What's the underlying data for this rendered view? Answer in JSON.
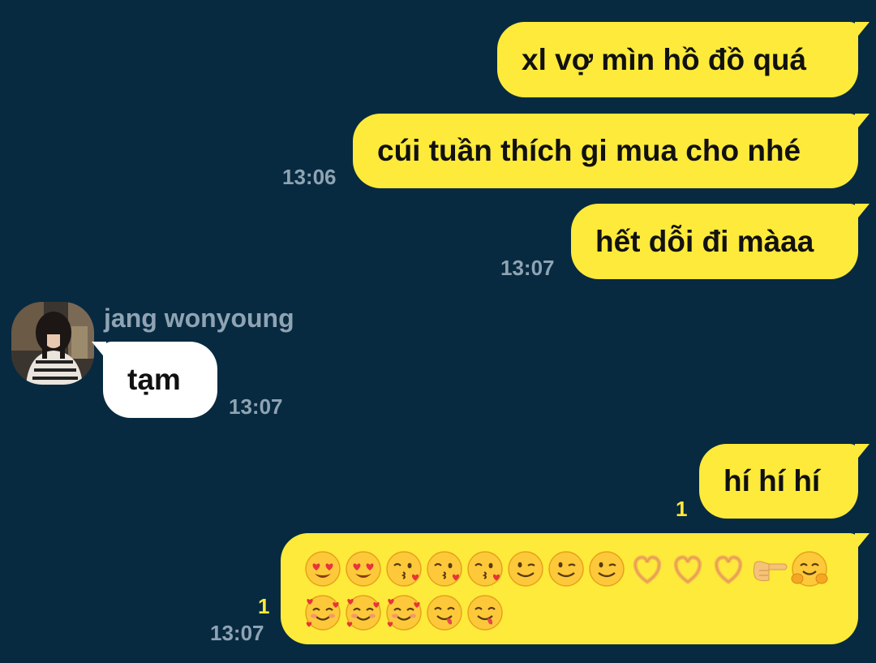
{
  "messages": {
    "m1": {
      "text": "xl vợ mìn hồ đồ quá"
    },
    "m2": {
      "text": "cúi tuần thích gi mua cho nhé",
      "time": "13:06"
    },
    "m3": {
      "text": "hết dỗi đi màaa",
      "time": "13:07"
    },
    "m4": {
      "sender": "jang wonyoung",
      "text": "tạm",
      "time": "13:07"
    },
    "m5": {
      "text": "hí hí hí",
      "unread": "1"
    },
    "m6": {
      "unread": "1",
      "time": "13:07",
      "emojis_row1": [
        "heart-eyes",
        "heart-eyes",
        "kiss-heart",
        "kiss-heart",
        "kiss-heart",
        "wink",
        "wink",
        "wink",
        "heart-hands",
        "heart-hands",
        "heart-hands",
        "pointing-right",
        "hugging"
      ],
      "emojis_row2": [
        "smiling-hearts",
        "smiling-hearts",
        "smiling-hearts",
        "yum",
        "yum"
      ]
    }
  },
  "colors": {
    "background": "#072A40",
    "outgoing_bubble": "#FEEA3A",
    "incoming_bubble": "#FFFFFF",
    "timestamp": "#8FA3B3",
    "unread_count": "#FEEA3A"
  }
}
